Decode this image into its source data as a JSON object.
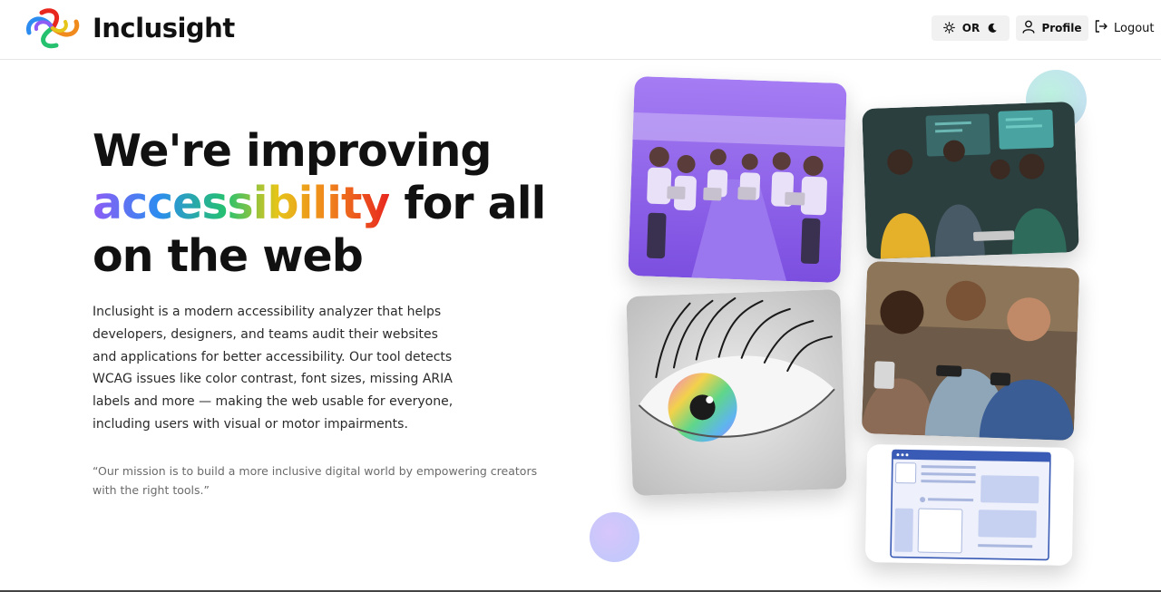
{
  "header": {
    "brand": "Inclusight",
    "theme_toggle_label": "OR",
    "profile_label": "Profile",
    "logout_label": "Logout"
  },
  "hero": {
    "headline_line1": "We're improving",
    "headline_highlight": "accessibility",
    "headline_line2_rest": " for all",
    "headline_line3": "on the web",
    "description": "Inclusight is a modern accessibility analyzer that helps developers, designers, and teams audit their websites and applications for better accessibility. Our tool detects WCAG issues like color contrast, font sizes, missing ARIA labels and more — making the web usable for everyone, including users with visual or motor impairments.",
    "quote": "“Our mission is to build a more inclusive digital world by empowering creators with the right tools.”"
  },
  "colors": {
    "accent_purple": "#8e5cf5",
    "card_purple": "#9b6cf0",
    "text_dark": "#111111"
  },
  "icons": {
    "sun": "sun-icon",
    "moon": "moon-icon",
    "user": "user-icon",
    "logout": "logout-icon"
  }
}
